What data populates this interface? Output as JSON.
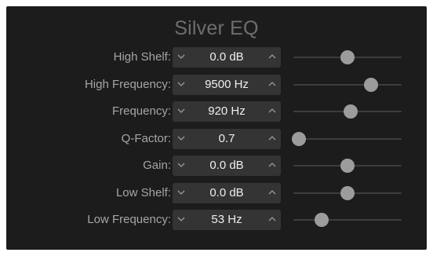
{
  "window": {
    "title": "Silver EQ"
  },
  "params": [
    {
      "label": "High Shelf:",
      "value": "0.0 dB",
      "level": 0.5
    },
    {
      "label": "High Frequency:",
      "value": "9500 Hz",
      "level": 0.72
    },
    {
      "label": "Frequency:",
      "value": "920 Hz",
      "level": 0.53
    },
    {
      "label": "Q-Factor:",
      "value": "0.7",
      "level": 0.05
    },
    {
      "label": "Gain:",
      "value": "0.0 dB",
      "level": 0.5
    },
    {
      "label": "Low Shelf:",
      "value": "0.0 dB",
      "level": 0.5
    },
    {
      "label": "Low Frequency:",
      "value": "53 Hz",
      "level": 0.26
    }
  ],
  "icons": {
    "decrement": "chevron-down-icon",
    "increment": "chevron-up-icon"
  },
  "colors": {
    "panel": "#1c1c1c",
    "title": "#6e6e6e",
    "label": "#a6a6a6",
    "stepper_bg": "#343434",
    "value_text": "#eeeeee",
    "track": "#3d3d3d",
    "thumb": "#9c9c9c"
  }
}
